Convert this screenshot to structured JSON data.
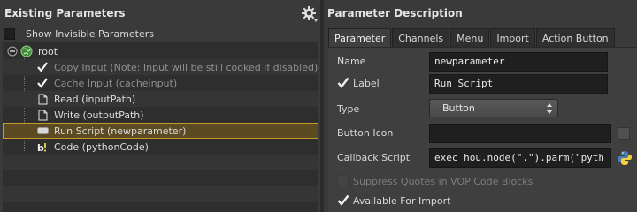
{
  "left": {
    "title": "Existing Parameters",
    "gear_icon": "gear-icon",
    "show_invisible": {
      "label": "Show Invisible Parameters",
      "checked": false
    },
    "tree": [
      {
        "text": "root",
        "icon": "globe-icon",
        "dim": false
      },
      {
        "text": "Copy Input (Note: Input will be still cooked if disabled) (copyinput)",
        "icon": "check-icon",
        "dim": true
      },
      {
        "text": "Cache Input (cacheinput)",
        "icon": "check-icon",
        "dim": true
      },
      {
        "text": "Read (inputPath)",
        "icon": "file-icon",
        "dim": false
      },
      {
        "text": "Write (outputPath)",
        "icon": "file-icon",
        "dim": false
      },
      {
        "text": "Run Script (newparameter)",
        "icon": "button-icon",
        "dim": false,
        "selected": true
      },
      {
        "text": "Code (pythonCode)",
        "icon": "code-icon",
        "dim": false
      }
    ]
  },
  "right": {
    "title": "Parameter Description",
    "tabs": [
      "Parameter",
      "Channels",
      "Menu",
      "Import",
      "Action Button"
    ],
    "active_tab": "Parameter",
    "name": {
      "label": "Name",
      "value": "newparameter"
    },
    "label_row": {
      "label": "Label",
      "value": "Run Script",
      "checked": true
    },
    "type": {
      "label": "Type",
      "value": "Button"
    },
    "button_icon": {
      "label": "Button Icon",
      "value": ""
    },
    "callback": {
      "label": "Callback Script",
      "value": "exec hou.node(\".\").parm(\"pyth"
    },
    "suppress": {
      "label": "Suppress Quotes in VOP Code Blocks",
      "checked": false
    },
    "available": {
      "label": "Available For Import",
      "checked": true
    }
  },
  "colors": {
    "selection_fill": "#5b4a22",
    "selection_border": "#c39a2c"
  }
}
